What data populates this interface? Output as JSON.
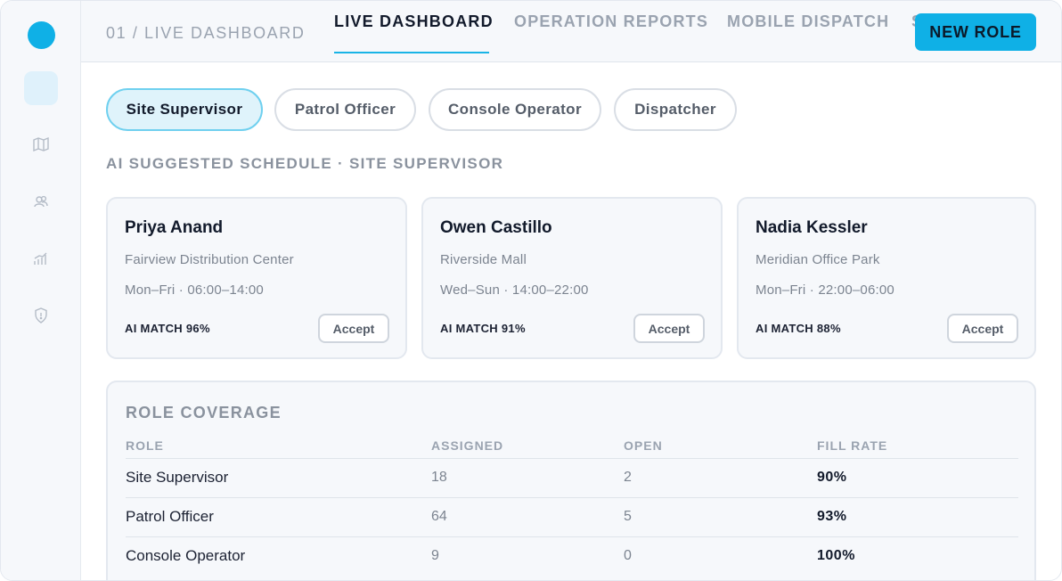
{
  "header": {
    "breadcrumb": "01 / LIVE DASHBOARD",
    "tabs": [
      {
        "label": "LIVE DASHBOARD",
        "active": true
      },
      {
        "label": "OPERATION REPORTS",
        "active": false
      },
      {
        "label": "MOBILE DISPATCH",
        "active": false
      },
      {
        "label": "S",
        "active": false
      }
    ],
    "new_role_label": "NEW ROLE"
  },
  "sidebar": {
    "items": [
      {
        "icon": "home-icon",
        "active": true
      },
      {
        "icon": "map-icon",
        "active": false
      },
      {
        "icon": "team-icon",
        "active": false
      },
      {
        "icon": "chart-icon",
        "active": false
      },
      {
        "icon": "shield-icon",
        "active": false
      }
    ]
  },
  "roles": {
    "pills": [
      "Site Supervisor",
      "Patrol Officer",
      "Console Operator",
      "Dispatcher"
    ],
    "selected": "Site Supervisor"
  },
  "schedule": {
    "title": "AI SUGGESTED SCHEDULE · SITE SUPERVISOR",
    "cards": [
      {
        "name": "Priya Anand",
        "site": "Fairview Distribution Center",
        "shift": "Mon–Fri · 06:00–14:00",
        "match": "AI MATCH 96%",
        "action": "Accept"
      },
      {
        "name": "Owen Castillo",
        "site": "Riverside Mall",
        "shift": "Wed–Sun · 14:00–22:00",
        "match": "AI MATCH 91%",
        "action": "Accept"
      },
      {
        "name": "Nadia Kessler",
        "site": "Meridian Office Park",
        "shift": "Mon–Fri · 22:00–06:00",
        "match": "AI MATCH 88%",
        "action": "Accept"
      }
    ]
  },
  "coverage": {
    "title": "ROLE COVERAGE",
    "columns": [
      "ROLE",
      "ASSIGNED",
      "OPEN",
      "FILL RATE"
    ],
    "rows": [
      {
        "role": "Site Supervisor",
        "assigned": "18",
        "open": "2",
        "fill_rate": "90%"
      },
      {
        "role": "Patrol Officer",
        "assigned": "64",
        "open": "5",
        "fill_rate": "93%"
      },
      {
        "role": "Console Operator",
        "assigned": "9",
        "open": "0",
        "fill_rate": "100%"
      }
    ]
  },
  "colors": {
    "accent": "#0fb0e6",
    "accent_light": "#dff3fb",
    "text_dark": "#121a2b",
    "text_muted": "#9aa3b0"
  }
}
